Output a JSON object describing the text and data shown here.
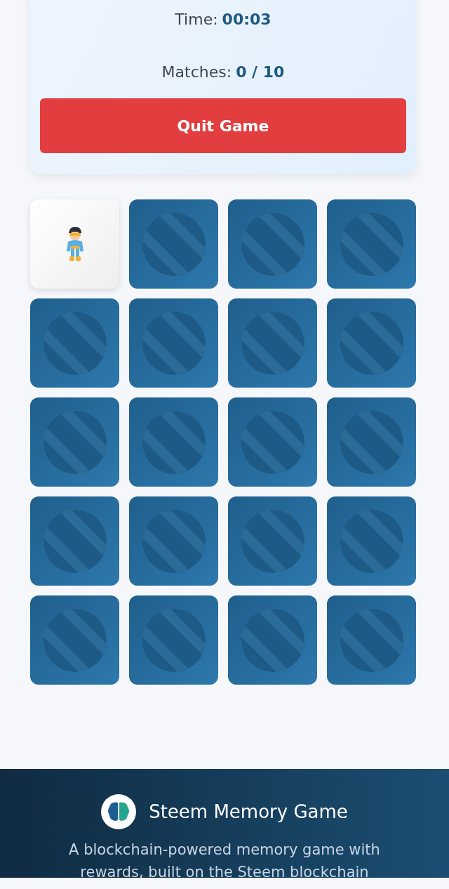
{
  "stats": [
    {
      "label": "Time:",
      "value": "00:03"
    },
    {
      "label": "Matches:",
      "value": "0 / 10"
    }
  ],
  "quit_button": "Quit Game",
  "cards": [
    {
      "face_up": true
    },
    {
      "face_up": false
    },
    {
      "face_up": false
    },
    {
      "face_up": false
    },
    {
      "face_up": false
    },
    {
      "face_up": false
    },
    {
      "face_up": false
    },
    {
      "face_up": false
    },
    {
      "face_up": false
    },
    {
      "face_up": false
    },
    {
      "face_up": false
    },
    {
      "face_up": false
    },
    {
      "face_up": false
    },
    {
      "face_up": false
    },
    {
      "face_up": false
    },
    {
      "face_up": false
    },
    {
      "face_up": false
    },
    {
      "face_up": false
    },
    {
      "face_up": false
    },
    {
      "face_up": false
    }
  ],
  "footer": {
    "title": "Steem Memory Game",
    "description": "A blockchain-powered memory game with rewards, built on the Steem blockchain"
  }
}
